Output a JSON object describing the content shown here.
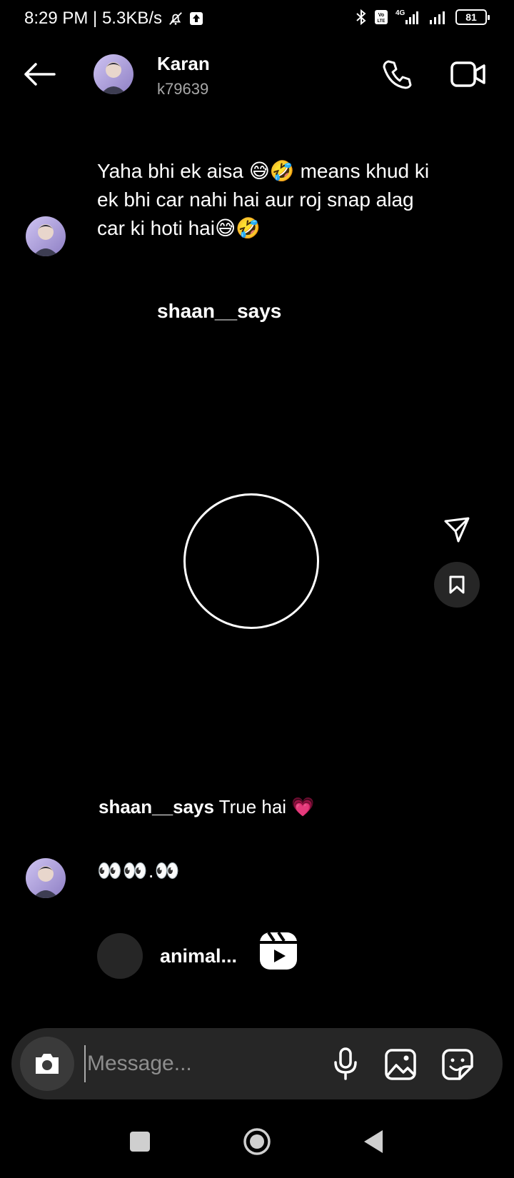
{
  "status_bar": {
    "time_speed": "8:29 PM | 5.3KB/s",
    "network_label": "4G",
    "volte_label": "Vo LTE",
    "battery": "81"
  },
  "header": {
    "name": "Karan",
    "username": "k79639"
  },
  "messages": {
    "text_message": "Yaha bhi ek aisa 😅🤣 means khud ki ek bhi car nahi hai aur roj snap alag car ki hoti hai😅🤣",
    "post_username": "shaan__says",
    "caption_user": "shaan__says",
    "caption_text": " True hai 💗",
    "emoji_message": "👀👀.👀",
    "reel_name": "animal..."
  },
  "composer": {
    "placeholder": "Message..."
  },
  "colors": {
    "background": "#000000",
    "composer_bg": "#262626",
    "secondary_text": "#a8a8a8"
  }
}
